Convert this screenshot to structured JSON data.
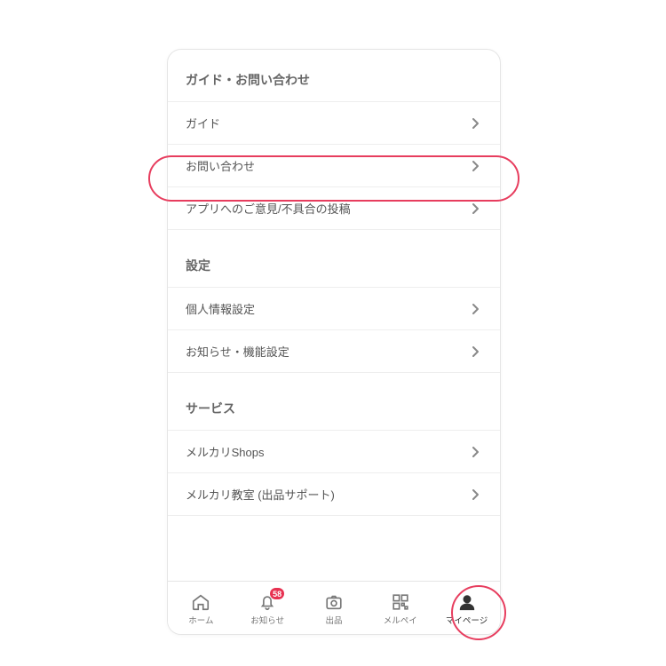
{
  "sections": [
    {
      "header": "ガイド・お問い合わせ",
      "items": [
        {
          "label": "ガイド",
          "name": "list-item-guide"
        },
        {
          "label": "お問い合わせ",
          "name": "list-item-contact"
        },
        {
          "label": "アプリへのご意見/不具合の投稿",
          "name": "list-item-feedback"
        }
      ]
    },
    {
      "header": "設定",
      "items": [
        {
          "label": "個人情報設定",
          "name": "list-item-personal-settings"
        },
        {
          "label": "お知らせ・機能設定",
          "name": "list-item-notif-settings"
        }
      ]
    },
    {
      "header": "サービス",
      "items": [
        {
          "label": "メルカリShops",
          "name": "list-item-shops"
        },
        {
          "label": "メルカリ教室 (出品サポート)",
          "name": "list-item-class"
        }
      ]
    }
  ],
  "tabs": {
    "home": "ホーム",
    "notice": "お知らせ",
    "sell": "出品",
    "pay": "メルペイ",
    "mypage": "マイページ",
    "badge": "58"
  },
  "highlight": {
    "row_target": "list-item-contact",
    "tab_target": "tab-mypage",
    "color": "#e73d5e"
  }
}
